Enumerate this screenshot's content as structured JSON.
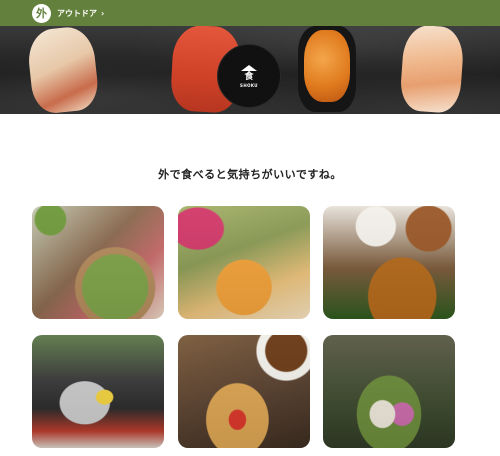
{
  "header": {
    "logo_glyph": "外",
    "category_label": "アウトドア",
    "chevron_icon": "chevron-right-icon",
    "bar_color": "#63803c"
  },
  "hero": {
    "badge_kanji": "食",
    "badge_sub": "SHOKU"
  },
  "main": {
    "heading": "外で食べると気持ちがいいですね。"
  },
  "gallery": {
    "items": [
      {
        "subject": "matcha"
      },
      {
        "subject": "mango-shaved-ice"
      },
      {
        "subject": "curry-skewers"
      },
      {
        "subject": "barbecue-grill"
      },
      {
        "subject": "waffle-strawberry"
      },
      {
        "subject": "bento-box"
      }
    ]
  }
}
